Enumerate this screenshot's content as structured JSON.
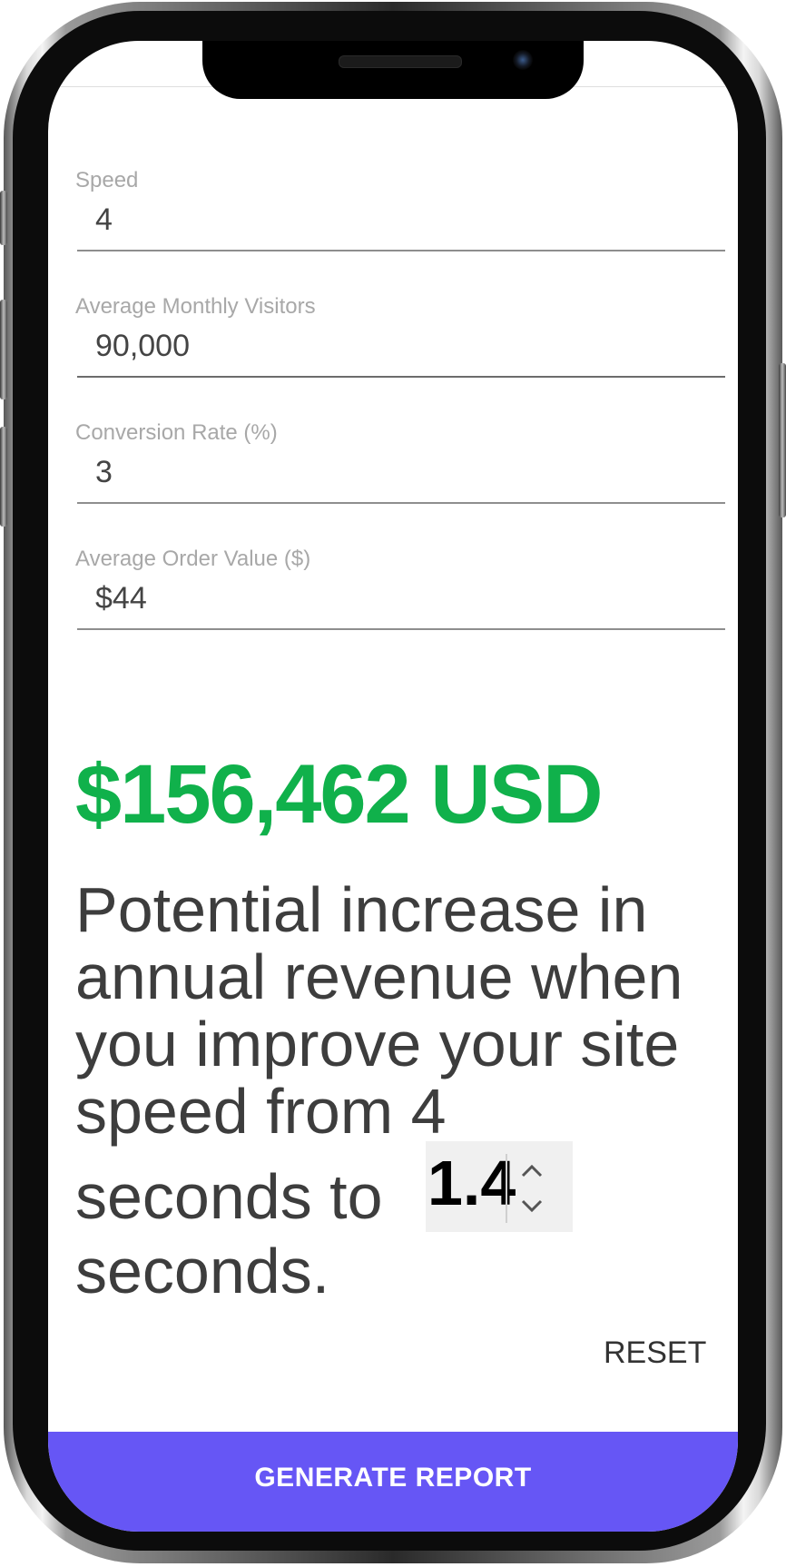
{
  "form": {
    "fields": [
      {
        "label": "Speed",
        "value": "4"
      },
      {
        "label": "Average Monthly Visitors",
        "value": "90,000"
      },
      {
        "label": "Conversion Rate (%)",
        "value": "3"
      },
      {
        "label": "Average Order Value ($)",
        "value": "$44"
      }
    ]
  },
  "result": {
    "amount": "$156,462 USD",
    "lines": [
      "Potential increase in",
      "annual revenue when",
      "you improve your site",
      "speed from 4",
      "seconds to",
      "seconds."
    ],
    "target_speed": "1.4"
  },
  "actions": {
    "reset_label": "RESET",
    "generate_label": "GENERATE REPORT"
  },
  "colors": {
    "accent_green": "#10b14b",
    "button_purple": "#6656f5"
  },
  "icons": [
    "chevron-up-icon",
    "chevron-down-icon"
  ]
}
